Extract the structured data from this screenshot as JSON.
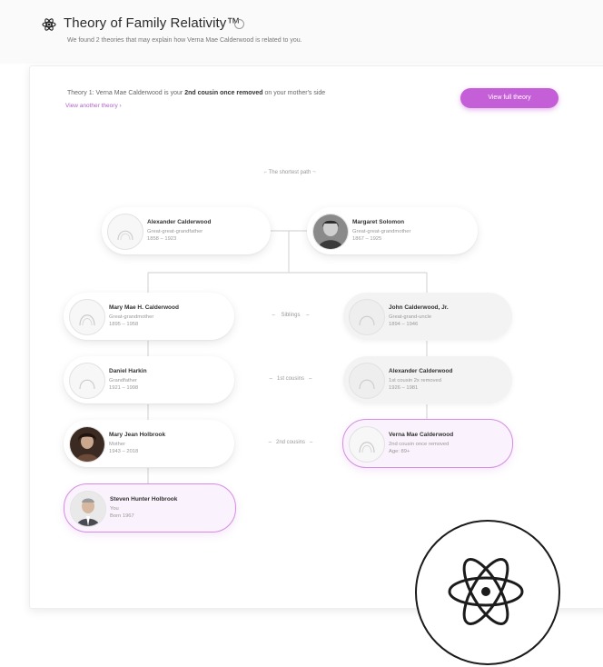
{
  "header": {
    "title": "Theory of Family Relativity™",
    "subtitle": "We found 2 theories that may explain how Verna Mae Calderwood is related to you.",
    "icons": {
      "brand": "atom-icon",
      "info": "info-icon"
    }
  },
  "theory": {
    "text_before": "Theory 1: Verna Mae Calderwood is your ",
    "text_bold": "2nd cousin once removed",
    "text_after": " on your mother's side",
    "link": "View another theory ›",
    "button": "View full theory"
  },
  "tree": {
    "shortest_label": "The shortest path",
    "people": [
      {
        "name": "Alexander Calderwood",
        "relation": "Great-great-grandfather",
        "dates": "1858 – 1923"
      },
      {
        "name": "Margaret Solomon",
        "relation": "Great-great-grandmother",
        "dates": "1867 – 1925"
      },
      {
        "name": "Mary Mae H. Calderwood",
        "relation": "Great-grandmother",
        "dates": "1895 – 1958"
      },
      {
        "name": "John Calderwood, Jr.",
        "relation": "Great-grand-uncle",
        "dates": "1894 – 1946"
      },
      {
        "name": "Daniel Harkin",
        "relation": "Grandfather",
        "dates": "1921 – 1998"
      },
      {
        "name": "Alexander Calderwood",
        "relation": "1st cousin 2x removed",
        "dates": "1926 – 1981"
      },
      {
        "name": "Mary Jean Holbrook",
        "relation": "Mother",
        "dates": "1943 – 2018"
      },
      {
        "name": "Verna Mae Calderwood",
        "relation": "2nd cousin once removed",
        "dates": "Age: 89+"
      },
      {
        "name": "Steven Hunter Holbrook",
        "relation": "You",
        "dates": "Born 1967"
      }
    ],
    "middle_labels": [
      "Siblings",
      "1st cousins",
      "2nd cousins"
    ]
  },
  "badge_icon": "atom-icon"
}
